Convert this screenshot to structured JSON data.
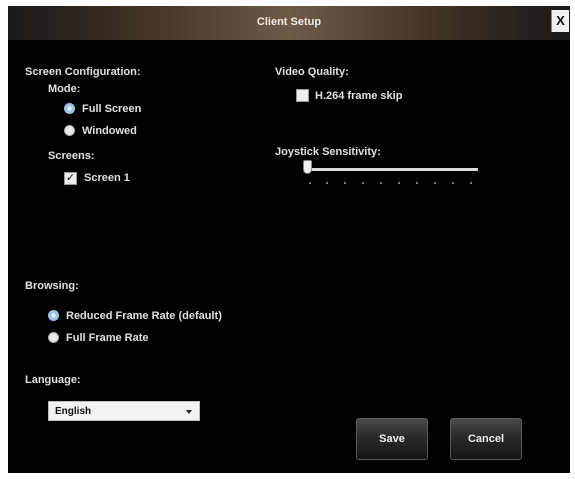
{
  "window": {
    "title": "Client Setup",
    "close_label": "X"
  },
  "screen_config": {
    "heading": "Screen Configuration:",
    "mode_label": "Mode:",
    "mode_options": [
      {
        "label": "Full Screen",
        "selected": true
      },
      {
        "label": "Windowed",
        "selected": false
      }
    ],
    "screens_label": "Screens:",
    "screens": [
      {
        "label": "Screen 1",
        "checked": true
      }
    ]
  },
  "video_quality": {
    "heading": "Video Quality:",
    "frame_skip_label": "H.264 frame skip",
    "frame_skip_checked": false
  },
  "joystick": {
    "heading": "Joystick Sensitivity:",
    "value": 0,
    "tick_count": 10
  },
  "browsing": {
    "heading": "Browsing:",
    "options": [
      {
        "label": "Reduced Frame Rate (default)",
        "selected": true
      },
      {
        "label": "Full Frame Rate",
        "selected": false
      }
    ]
  },
  "language": {
    "heading": "Language:",
    "selected": "English"
  },
  "buttons": {
    "save": "Save",
    "cancel": "Cancel"
  },
  "colors": {
    "background": "#000000",
    "title_bar": "#6f5a48",
    "selected_radio": "#9bc4e6"
  }
}
